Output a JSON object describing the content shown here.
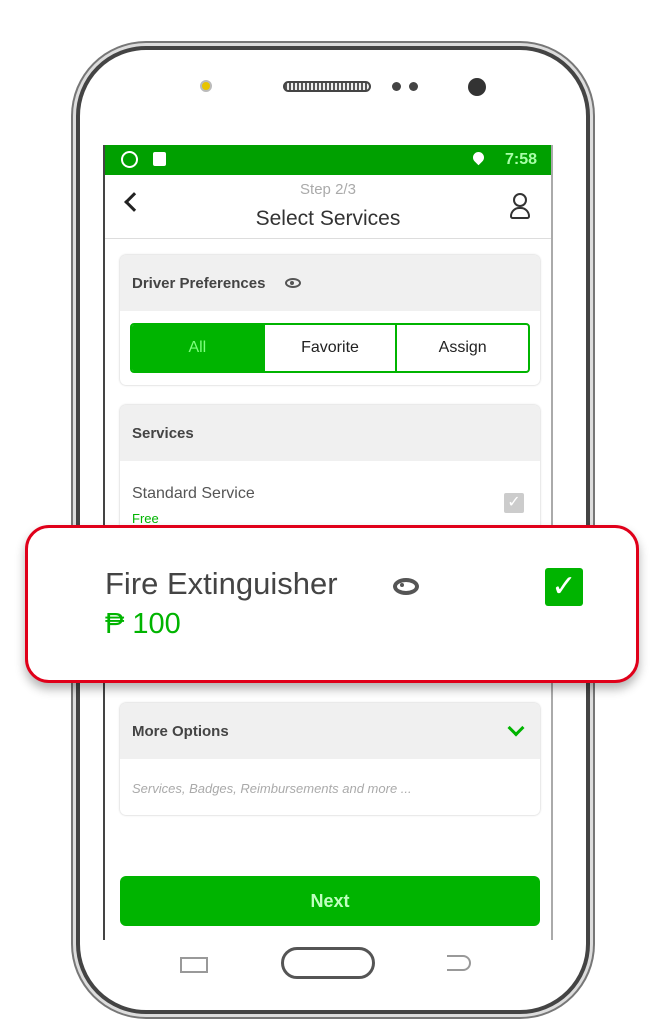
{
  "status_bar": {
    "time": "7:58",
    "icons": [
      "whatsapp-icon",
      "app-notification-icon",
      "location-pin-icon"
    ]
  },
  "header": {
    "step": "Step 2/3",
    "title": "Select Services",
    "back_icon": "chevron-left-icon",
    "support_icon": "headset-support-icon"
  },
  "driver_preferences": {
    "title": "Driver Preferences",
    "options": [
      {
        "label": "All",
        "selected": true
      },
      {
        "label": "Favorite",
        "selected": false
      },
      {
        "label": "Assign",
        "selected": false
      }
    ]
  },
  "services": {
    "title": "Services",
    "items": [
      {
        "name": "Standard Service",
        "price": "Free",
        "checked": true,
        "disabled": true
      }
    ]
  },
  "highlight": {
    "name": "Fire Extinguisher",
    "currency": "₱",
    "price": "100",
    "checked": true
  },
  "more_options": {
    "title": "More Options",
    "subtitle": "Services, Badges, Reimbursements and more ..."
  },
  "next_label": "Next",
  "colors": {
    "accent": "#00b400",
    "status_bar": "#00a000",
    "highlight_border": "#e0001a"
  }
}
